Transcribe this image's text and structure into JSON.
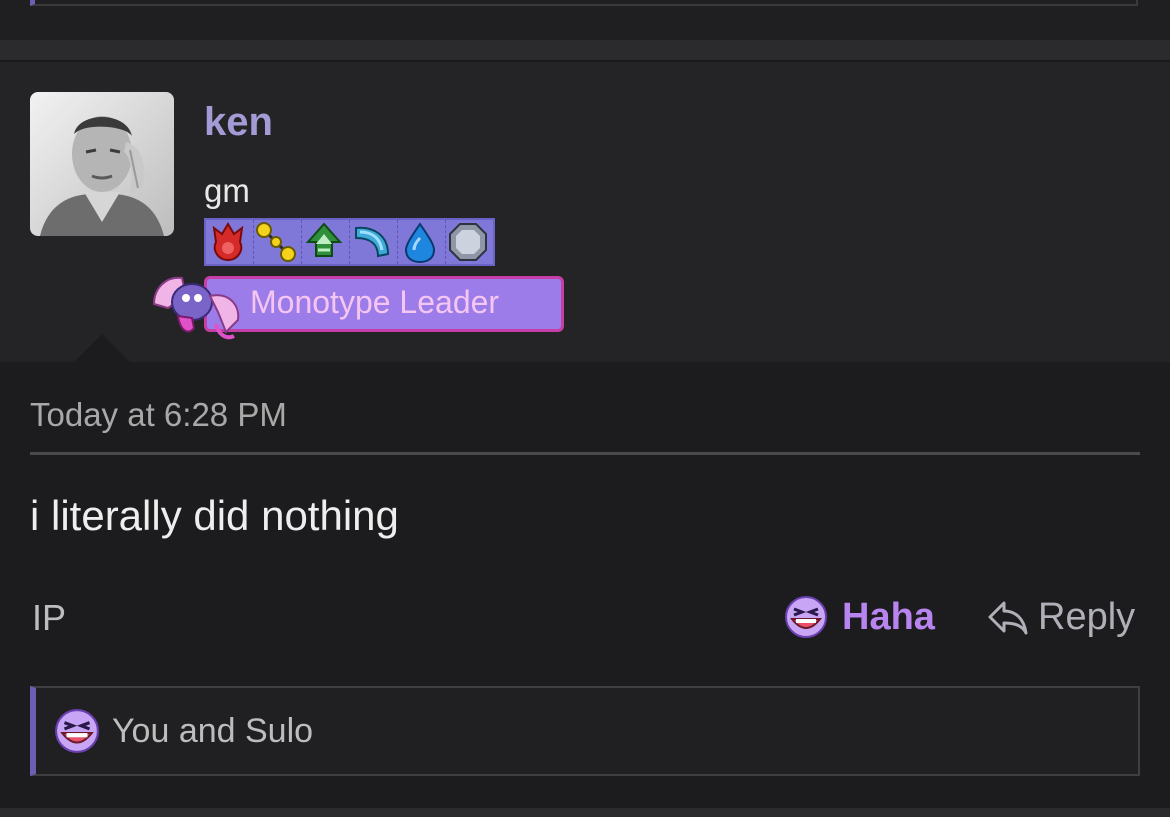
{
  "post": {
    "username": "ken",
    "user_title": "gm",
    "banner_label": "Monotype Leader",
    "type_icons": [
      "fire-type-icon",
      "electric-type-icon",
      "grass-type-icon",
      "dragon-type-icon",
      "water-type-icon",
      "steel-type-icon"
    ],
    "timestamp": "Today at 6:28 PM",
    "message": "i literally did nothing",
    "actions": {
      "ip_label": "IP",
      "haha_label": "Haha",
      "reply_label": "Reply"
    },
    "reactions_summary": "You and Sulo"
  },
  "colors": {
    "username": "#a39bd6",
    "accent": "#b784f0",
    "banner_bg": "#9c7ce8",
    "banner_border": "#c83ea8",
    "reaction_bar_accent": "#6b5fb3"
  }
}
